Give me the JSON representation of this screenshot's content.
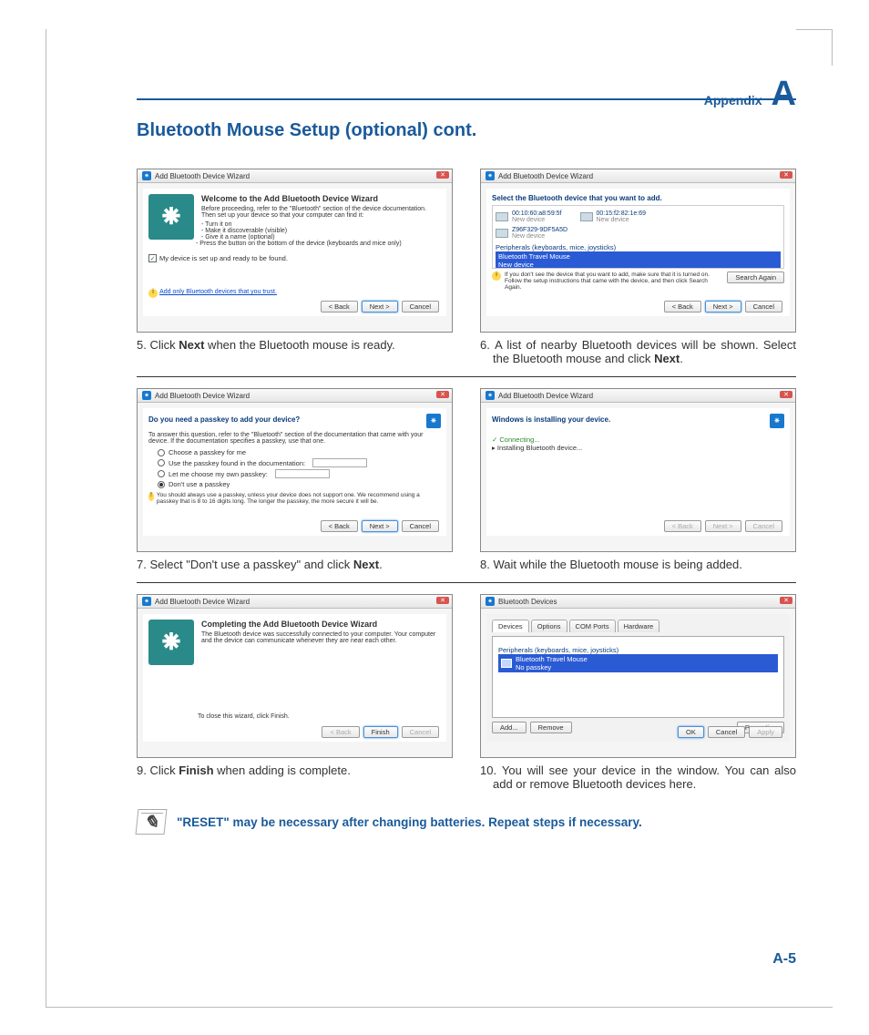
{
  "header": {
    "appendix_label": "Appendix",
    "appendix_letter": "A"
  },
  "section_title": "Bluetooth Mouse Setup (optional) cont.",
  "dialogs": {
    "wizard_title": "Add Bluetooth Device Wizard",
    "s5": {
      "heading": "Welcome to the Add Bluetooth Device Wizard",
      "intro": "Before proceeding, refer to the \"Bluetooth\" section of the device documentation. Then set up your device so that your computer can find it:",
      "bullets": [
        "- Turn it on",
        "- Make it discoverable (visible)",
        "- Give it a name (optional)",
        "- Press the button on the bottom of the device (keyboards and mice only)"
      ],
      "checkbox": "My device is set up and ready to be found.",
      "trust_link": "Add only Bluetooth devices that you trust.",
      "buttons": [
        "< Back",
        "Next >",
        "Cancel"
      ]
    },
    "s6": {
      "sub": "Select the Bluetooth device that you want to add.",
      "dev_a_name": "00:10:60:a8:59:5f",
      "dev_a_sub": "New device",
      "dev_b_name": "00:15:f2:82:1e:69",
      "dev_b_sub": "New device",
      "dev_c_name": "Z96F329-9DF5A5D",
      "dev_c_sub": "New device",
      "group": "Peripherals (keyboards, mice, joysticks)",
      "sel_name": "Bluetooth Travel Mouse",
      "sel_sub": "New device",
      "tip": "If you don't see the device that you want to add, make sure that it is turned on. Follow the setup instructions that came with the device, and then click Search Again.",
      "search_btn": "Search Again",
      "buttons": [
        "< Back",
        "Next >",
        "Cancel"
      ]
    },
    "s7": {
      "sub": "Do you need a passkey to add your device?",
      "intro": "To answer this question, refer to the \"Bluetooth\" section of the documentation that came with your device. If the documentation specifies a passkey, use that one.",
      "r1": "Choose a passkey for me",
      "r2": "Use the passkey found in the documentation:",
      "r3": "Let me choose my own passkey:",
      "r4": "Don't use a passkey",
      "warn": "You should always use a passkey, unless your device does not support one. We recommend using a passkey that is 8 to 16 digits long. The longer the passkey, the more secure it will be.",
      "buttons": [
        "< Back",
        "Next >",
        "Cancel"
      ]
    },
    "s8": {
      "sub": "Windows is installing your device.",
      "line1": "Connecting...",
      "line2": "Installing Bluetooth device...",
      "buttons": [
        "< Back",
        "Next >",
        "Cancel"
      ]
    },
    "s9": {
      "heading": "Completing the Add Bluetooth Device Wizard",
      "intro": "The Bluetooth device was successfully connected to your computer. Your computer and the device can communicate whenever they are near each other.",
      "close": "To close this wizard, click Finish.",
      "buttons": [
        "< Back",
        "Finish",
        "Cancel"
      ]
    },
    "s10": {
      "title": "Bluetooth Devices",
      "tabs": [
        "Devices",
        "Options",
        "COM Ports",
        "Hardware"
      ],
      "group": "Peripherals (keyboards, mice, joysticks)",
      "item_name": "Bluetooth Travel Mouse",
      "item_sub": "No passkey",
      "btn_add": "Add...",
      "btn_remove": "Remove",
      "btn_props": "Properties",
      "btn_ok": "OK",
      "btn_cancel": "Cancel",
      "btn_apply": "Apply"
    }
  },
  "captions": {
    "c5_num": "5.",
    "c5_pre": "Click ",
    "c5_bold": "Next",
    "c5_post": " when the Bluetooth mouse is ready.",
    "c6_num": "6.",
    "c6_pre": "A list of nearby Bluetooth devices will be shown. Select the Bluetooth mouse and click ",
    "c6_bold": "Next",
    "c6_post": ".",
    "c7_num": "7.",
    "c7_pre": "Select \"Don't use a passkey\" and click ",
    "c7_bold": "Next",
    "c7_post": ".",
    "c8_num": "8.",
    "c8_text": "Wait while the Bluetooth mouse is being added.",
    "c9_num": "9.",
    "c9_pre": "Click ",
    "c9_bold": "Finish",
    "c9_post": " when adding is complete.",
    "c10_num": "10.",
    "c10_text": "You will see your device in the window. You can also add or remove Bluetooth devices here."
  },
  "note": "\"RESET\" may be necessary after changing batteries. Repeat steps if necessary.",
  "page_number": "A-5"
}
